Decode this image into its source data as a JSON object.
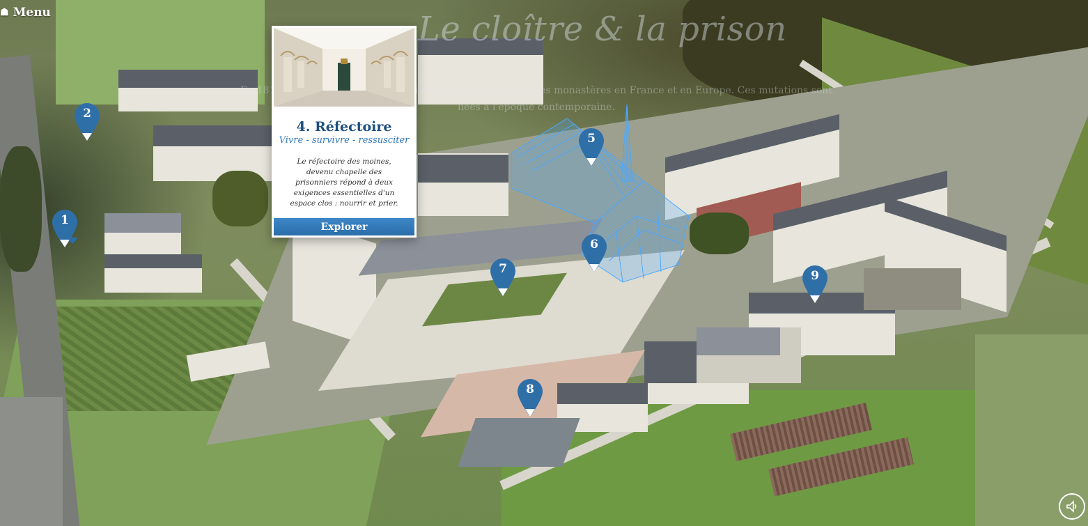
{
  "menu": {
    "label": "Menu",
    "icon": "menu-icon"
  },
  "title": "Le cloître & la prison",
  "intro": "En 1817, l'abbaye de Clairvaux devient prison comme d'autres monastères en France et en Europe. Ces mutations sont liées à l'époque contemporaine.",
  "card": {
    "title": "4. Réfectoire",
    "subtitle": "Vivre - survivre - ressusciter",
    "text": "Le réfectoire des moines, devenu chapelle des prisonniers répond à deux exigences essentielles d'un espace clos : nourrir et prier.",
    "button": "Explorer"
  },
  "pins": [
    {
      "number": "1"
    },
    {
      "number": "2"
    },
    {
      "number": "5"
    },
    {
      "number": "6"
    },
    {
      "number": "7"
    },
    {
      "number": "8"
    },
    {
      "number": "9"
    }
  ],
  "colors": {
    "pin": "#2f6fa8",
    "accent": "#2b6ea9",
    "title": "#1e4f7e",
    "wireframe": "#4aa8ff"
  },
  "sound": {
    "icon": "sound-icon"
  }
}
